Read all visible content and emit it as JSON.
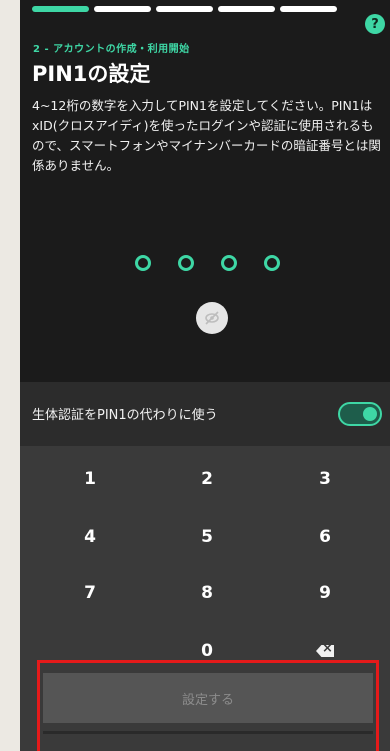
{
  "progress": {
    "total_steps": 6,
    "active_step": 1
  },
  "help_label": "?",
  "header": {
    "step_label": "2 - アカウントの作成・利用開始",
    "title": "PIN1の設定",
    "description": "4~12桁の数字を入力してPIN1を設定してください。PIN1はxID(クロスアイディ)を使ったログインや認証に使用されるもので、スマートフォンやマイナンバーカードの暗証番号とは関係ありません。"
  },
  "pin": {
    "entered_count": 0,
    "slots": 4
  },
  "biometric": {
    "label": "生体認証をPIN1の代わりに使う",
    "enabled": true
  },
  "keypad": {
    "rows": [
      [
        "1",
        "2",
        "3"
      ],
      [
        "4",
        "5",
        "6"
      ],
      [
        "7",
        "8",
        "9"
      ],
      [
        "",
        "0",
        "backspace"
      ]
    ]
  },
  "submit_label": "設定する",
  "colors": {
    "accent": "#3ed7a5",
    "background": "#1b1b1b",
    "keypad_bg": "#3a3a3a",
    "highlight": "#e51a1a"
  }
}
